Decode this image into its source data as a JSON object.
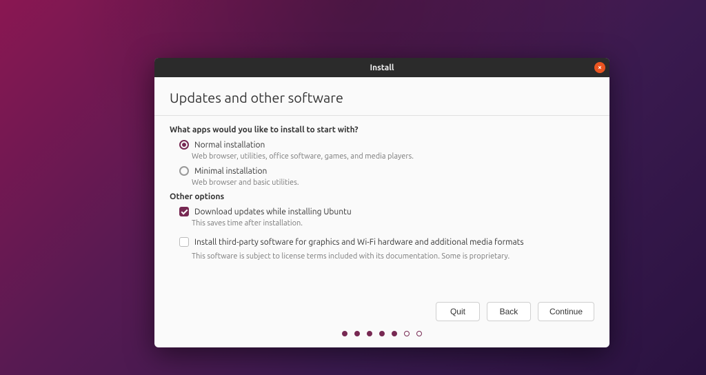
{
  "window": {
    "title": "Install",
    "close_glyph": "×"
  },
  "page": {
    "heading": "Updates and other software",
    "q_apps": "What apps would you like to install to start with?",
    "normal": {
      "label": "Normal installation",
      "desc": "Web browser, utilities, office software, games, and media players."
    },
    "minimal": {
      "label": "Minimal installation",
      "desc": "Web browser and basic utilities."
    },
    "other_options": "Other options",
    "download_updates": {
      "label": "Download updates while installing Ubuntu",
      "desc": "This saves time after installation."
    },
    "third_party": {
      "label": "Install third-party software for graphics and Wi-Fi hardware and additional media formats",
      "desc": "This software is subject to license terms included with its documentation. Some is proprietary."
    }
  },
  "buttons": {
    "quit": "Quit",
    "back": "Back",
    "continue": "Continue"
  },
  "progress": {
    "total": 7,
    "current": 5
  }
}
